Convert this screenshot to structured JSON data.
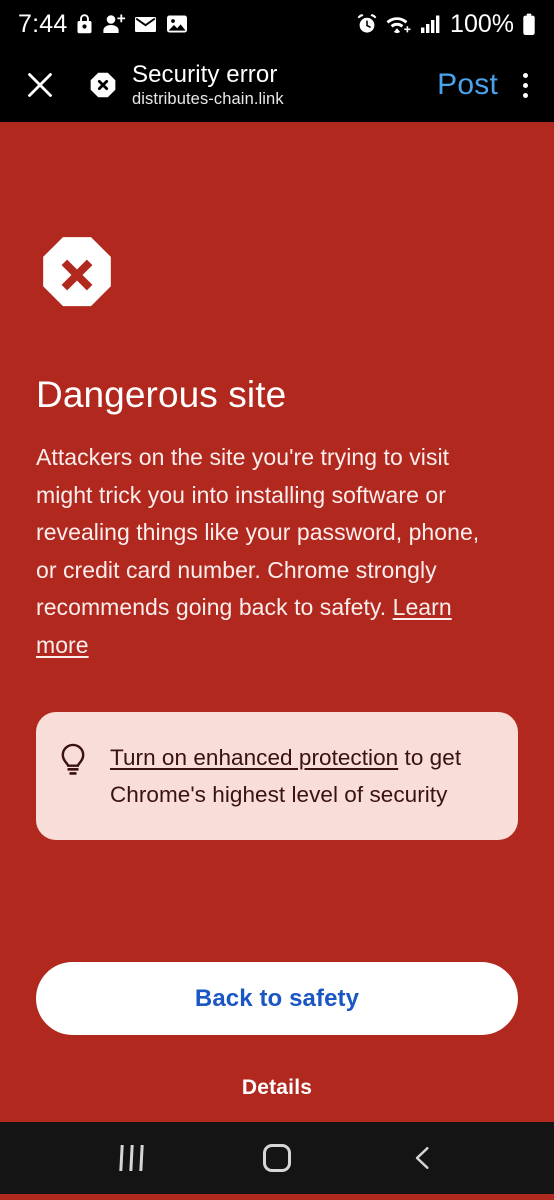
{
  "status_bar": {
    "time": "7:44",
    "battery_percent": "100%",
    "left_icons": [
      "lock-icon",
      "person-add-icon",
      "mail-icon",
      "image-icon"
    ],
    "right_icons": [
      "alarm-icon",
      "wifi-icon",
      "signal-bars-icon",
      "battery-icon"
    ]
  },
  "app_bar": {
    "close_label": "close-icon",
    "security_icon": "security-error-octagon-icon",
    "title": "Security error",
    "subtitle": "distributes-chain.link",
    "post_label": "Post",
    "overflow_label": "more-options-icon"
  },
  "interstitial": {
    "icon": "stop-sign-x-icon",
    "heading": "Dangerous site",
    "body_before_link": "Attackers on the site you're trying to visit might trick you into installing software or revealing things like your password, phone, or credit card number. Chrome strongly recommends going back to safety. ",
    "body_link": "Learn more",
    "tip": {
      "icon": "lightbulb-icon",
      "link_text": "Turn on enhanced protection",
      "rest_text": " to get Chrome's highest level of security"
    },
    "primary_button": "Back to safety",
    "details_link": "Details"
  },
  "nav_bar": {
    "recents_label": "recents-icon",
    "home_label": "home-icon",
    "back_label": "back-icon"
  },
  "colors": {
    "danger_red": "#b1281f",
    "tip_card_pink": "#f8ddd9",
    "tip_text_dark": "#3a120e",
    "post_blue": "#4aa3ea",
    "button_blue": "#1a56c4",
    "bar_black": "#000000",
    "nav_black": "#141414"
  }
}
